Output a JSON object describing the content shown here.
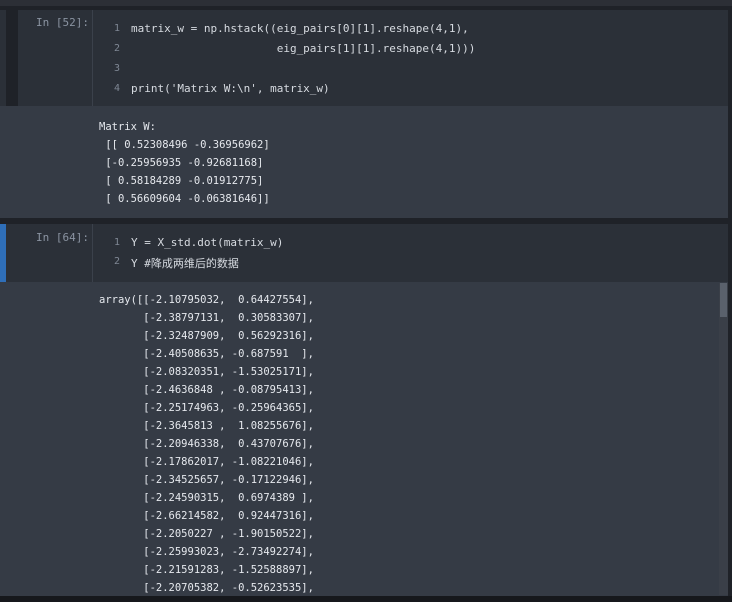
{
  "cells": [
    {
      "prompt": "In  [52]:",
      "lines": [
        {
          "n": "1",
          "text": "matrix_w = np.hstack((eig_pairs[0][1].reshape(4,1),"
        },
        {
          "n": "2",
          "text": "                      eig_pairs[1][1].reshape(4,1)))"
        },
        {
          "n": "3",
          "text": ""
        },
        {
          "n": "4",
          "text": "print('Matrix W:\\n', matrix_w)"
        }
      ],
      "output": [
        "Matrix W:",
        " [[ 0.52308496 -0.36956962]",
        " [-0.25956935 -0.92681168]",
        " [ 0.58184289 -0.01912775]",
        " [ 0.56609604 -0.06381646]]"
      ]
    },
    {
      "prompt": "In  [64]:",
      "lines": [
        {
          "n": "1",
          "text": "Y = X_std.dot(matrix_w)"
        },
        {
          "n": "2",
          "text": "Y #降成两维后的数据"
        }
      ],
      "output": [
        "array([[-2.10795032,  0.64427554],",
        "       [-2.38797131,  0.30583307],",
        "       [-2.32487909,  0.56292316],",
        "       [-2.40508635, -0.687591  ],",
        "       [-2.08320351, -1.53025171],",
        "       [-2.4636848 , -0.08795413],",
        "       [-2.25174963, -0.25964365],",
        "       [-2.3645813 ,  1.08255676],",
        "       [-2.20946338,  0.43707676],",
        "       [-2.17862017, -1.08221046],",
        "       [-2.34525657, -0.17122946],",
        "       [-2.24590315,  0.6974389 ],",
        "       [-2.66214582,  0.92447316],",
        "       [-2.2050227 , -1.90150522],",
        "       [-2.25993023, -2.73492274],",
        "       [-2.21591283, -1.52588897],",
        "       [-2.20705382, -0.52623535],"
      ]
    }
  ]
}
